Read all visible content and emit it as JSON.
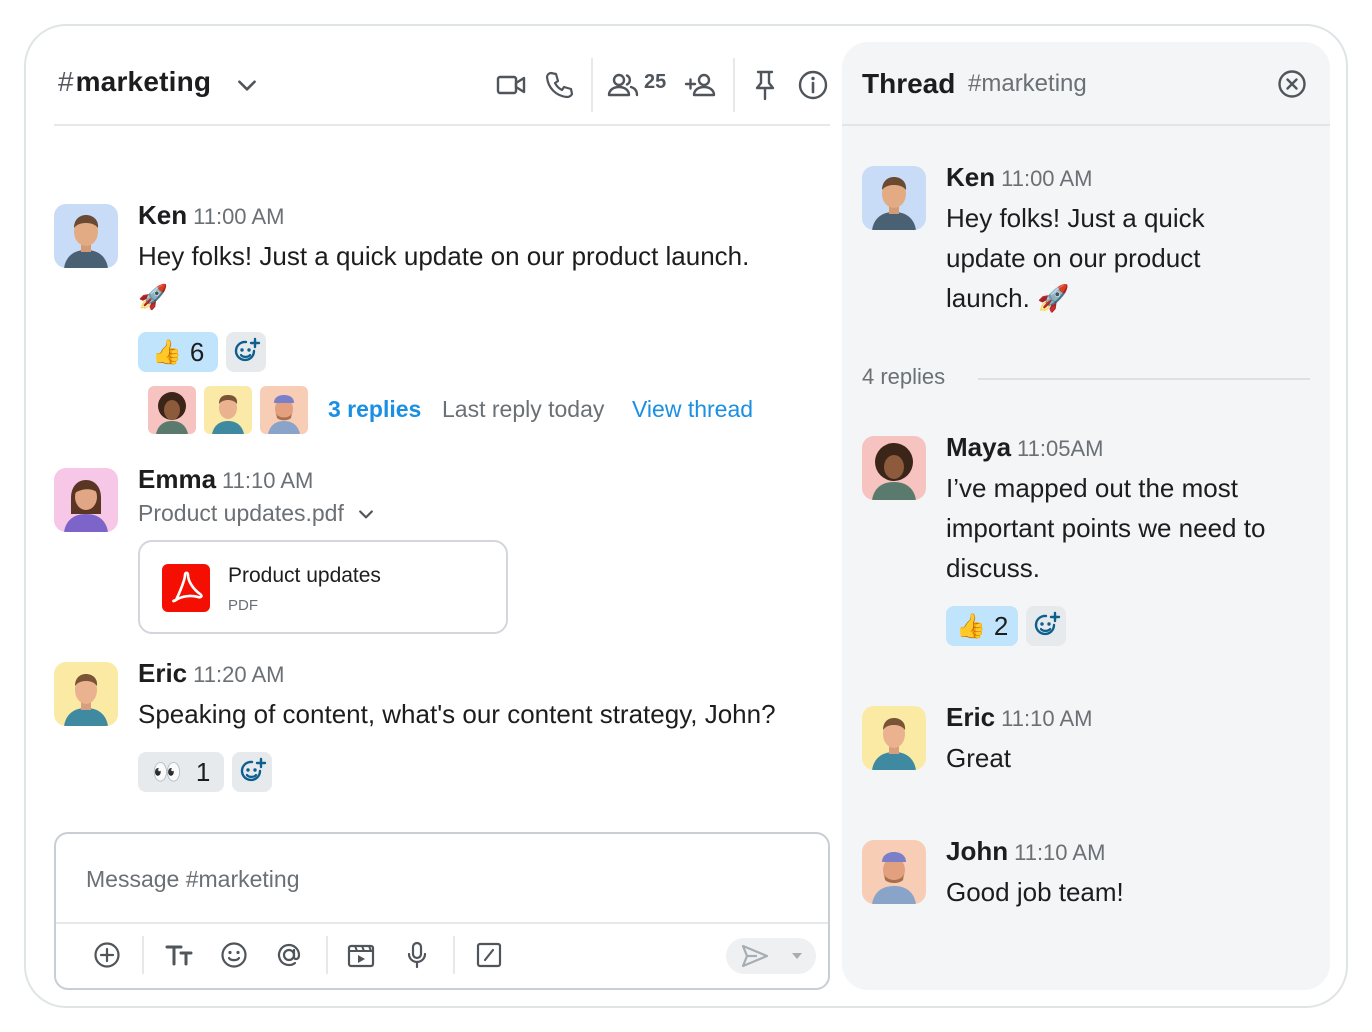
{
  "channel": {
    "hash": "#",
    "name": "marketing",
    "member_count": "25"
  },
  "messages": [
    {
      "author": "Ken",
      "time": "11:00 AM",
      "text": "Hey folks! Just a quick update on our product launch.",
      "emoji": "🚀",
      "reaction": {
        "emoji": "👍",
        "count": "6"
      },
      "thread": {
        "replies": "3 replies",
        "last_reply": "Last reply today",
        "view": "View thread"
      }
    },
    {
      "author": "Emma",
      "time": "11:10 AM",
      "attachment_label": "Product updates.pdf",
      "file": {
        "name": "Product updates",
        "type": "PDF"
      }
    },
    {
      "author": "Eric",
      "time": "11:20 AM",
      "text": "Speaking of content, what's our content strategy, John?",
      "reaction": {
        "emoji": "👀",
        "count": "1"
      }
    }
  ],
  "composer": {
    "placeholder": "Message #marketing"
  },
  "thread": {
    "title": "Thread",
    "channel": "#marketing",
    "parent": {
      "author": "Ken",
      "time": "11:00 AM",
      "text": "Hey folks! Just a quick update on our product launch. 🚀"
    },
    "replies_count": "4 replies",
    "replies": [
      {
        "author": "Maya",
        "time": "11:05AM",
        "text": "I’ve mapped out the most important points we need to discuss.",
        "reaction": {
          "emoji": "👍",
          "count": "2"
        }
      },
      {
        "author": "Eric",
        "time": "11:10 AM",
        "text": "Great"
      },
      {
        "author": "John",
        "time": "11:10 AM",
        "text": "Good job team!"
      }
    ]
  },
  "icons": [
    "chevron-down-icon",
    "video-icon",
    "phone-icon",
    "members-icon",
    "add-member-icon",
    "pin-icon",
    "info-icon",
    "close-icon",
    "add-reaction-icon",
    "plus-circle-icon",
    "text-format-icon",
    "emoji-icon",
    "mention-icon",
    "media-icon",
    "microphone-icon",
    "slash-command-icon",
    "send-icon",
    "pdf-icon"
  ],
  "colors": {
    "accent": "#1a8fe3",
    "reaction_active": "#bfe4fb",
    "pdf_red": "#f40f02",
    "thread_bg": "#f3f5f7"
  }
}
